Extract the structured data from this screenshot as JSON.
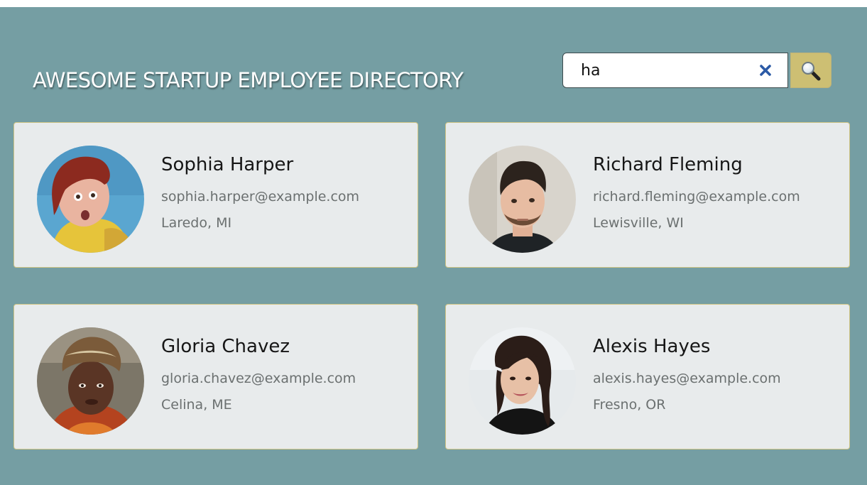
{
  "header": {
    "title": "AWESOME STARTUP EMPLOYEE DIRECTORY"
  },
  "search": {
    "value": "ha",
    "clear_icon": "close-icon",
    "button_icon": "magnifying-glass-icon"
  },
  "colors": {
    "background": "#759ea3",
    "card": "#e8ebec",
    "card_border": "#cfc484",
    "search_button": "#cdbf73",
    "clear_icon": "#2b5aa6"
  },
  "employees": [
    {
      "name": "Sophia Harper",
      "email": "sophia.harper@example.com",
      "location": "Laredo, MI"
    },
    {
      "name": "Richard Fleming",
      "email": "richard.fleming@example.com",
      "location": "Lewisville, WI"
    },
    {
      "name": "Gloria Chavez",
      "email": "gloria.chavez@example.com",
      "location": "Celina, ME"
    },
    {
      "name": "Alexis Hayes",
      "email": "alexis.hayes@example.com",
      "location": "Fresno, OR"
    }
  ]
}
